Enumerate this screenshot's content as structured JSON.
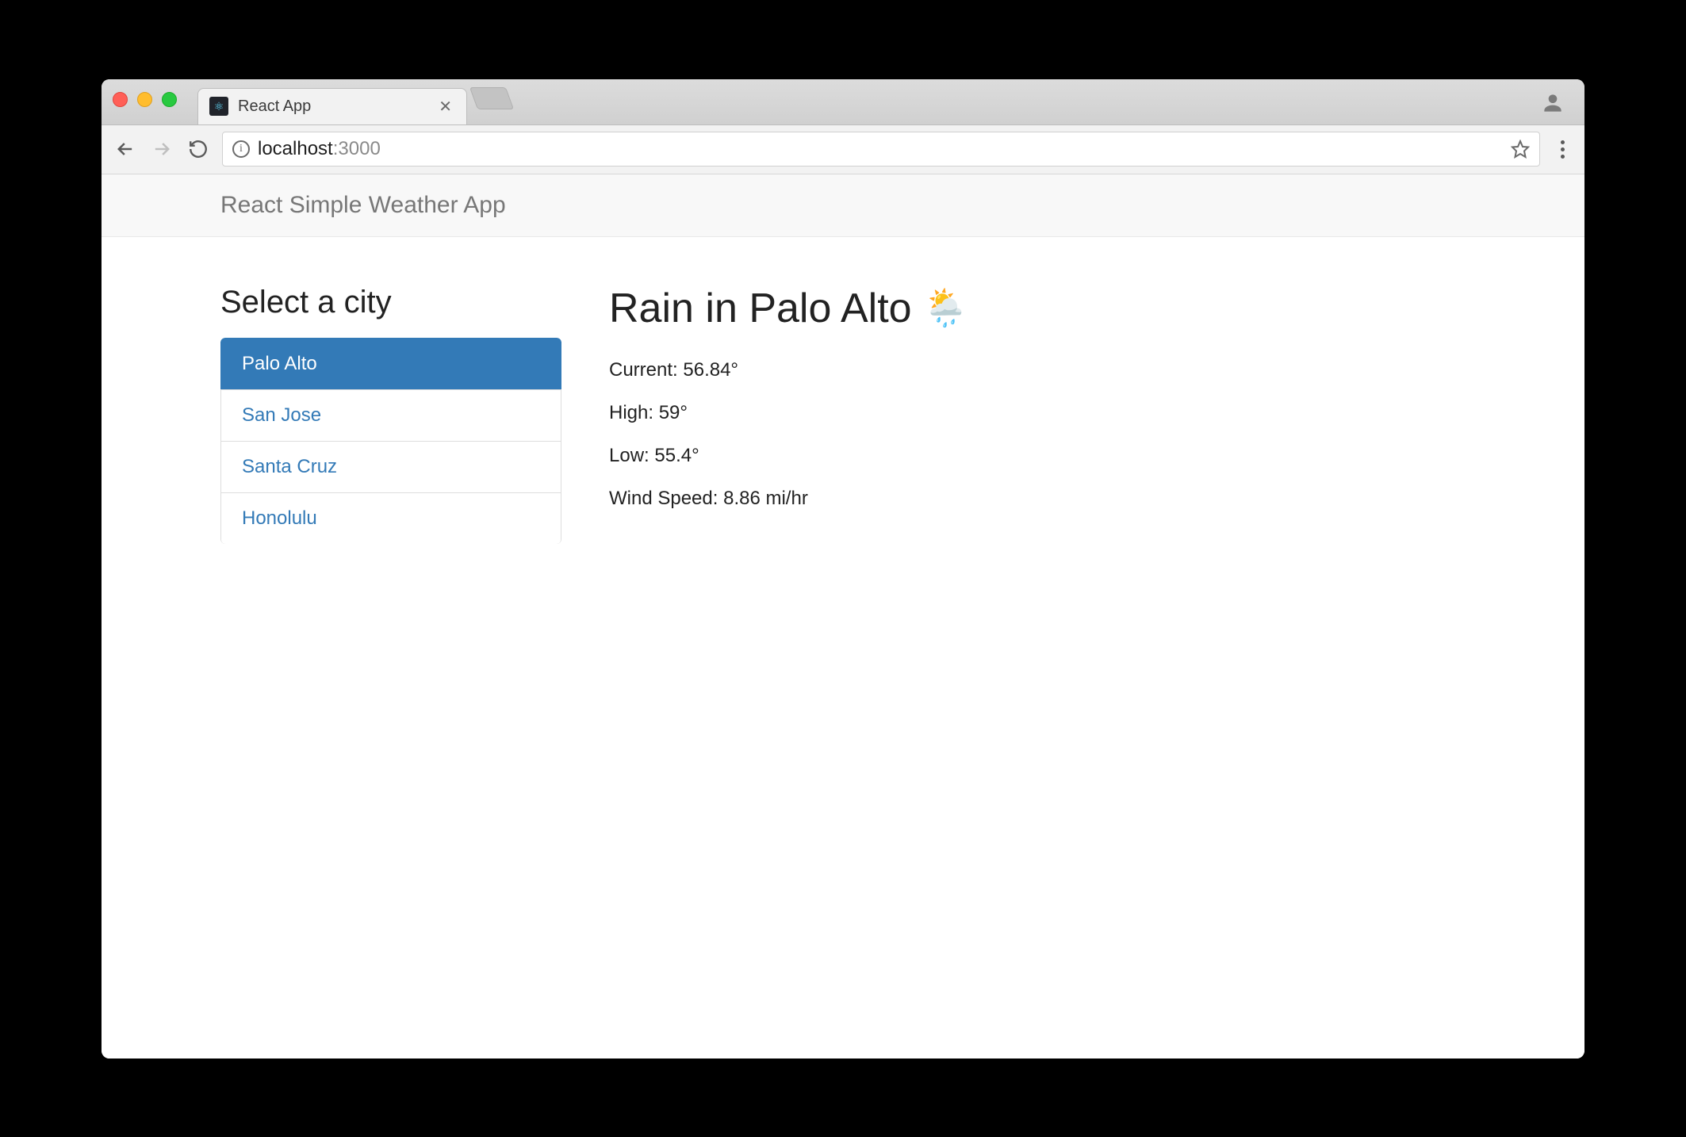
{
  "browser": {
    "tab_title": "React App",
    "url_host": "localhost",
    "url_port": ":3000"
  },
  "header": {
    "title": "React Simple Weather App"
  },
  "sidebar": {
    "heading": "Select a city",
    "items": [
      {
        "label": "Palo Alto",
        "active": true
      },
      {
        "label": "San Jose",
        "active": false
      },
      {
        "label": "Santa Cruz",
        "active": false
      },
      {
        "label": "Honolulu",
        "active": false
      }
    ]
  },
  "weather": {
    "heading": "Rain in Palo Alto",
    "emoji": "🌦️",
    "details": {
      "current_label": "Current:",
      "current_value": "56.84°",
      "high_label": "High:",
      "high_value": "59°",
      "low_label": "Low:",
      "low_value": "55.4°",
      "wind_label": "Wind Speed:",
      "wind_value": "8.86 mi/hr"
    }
  },
  "colors": {
    "primary": "#337ab7",
    "text": "#222222",
    "muted": "#777777"
  }
}
